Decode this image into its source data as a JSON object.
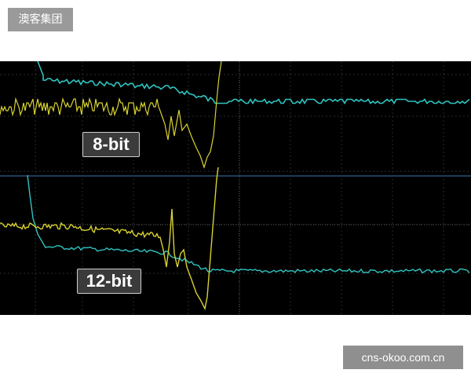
{
  "header_badge": {
    "text": "澳客集团"
  },
  "scope": {
    "labels": {
      "top": "8-bit",
      "bottom": "12-bit"
    },
    "colors": {
      "background": "#000000",
      "grid": "#2a2a2a",
      "center_axis": "#5a5a5a",
      "cyan_trace": "#2fc4c0",
      "yellow_trace": "#d8d230",
      "divider": "#1f3b57"
    }
  },
  "footer_badge": {
    "text": "cns-okoo.com.cn"
  }
}
